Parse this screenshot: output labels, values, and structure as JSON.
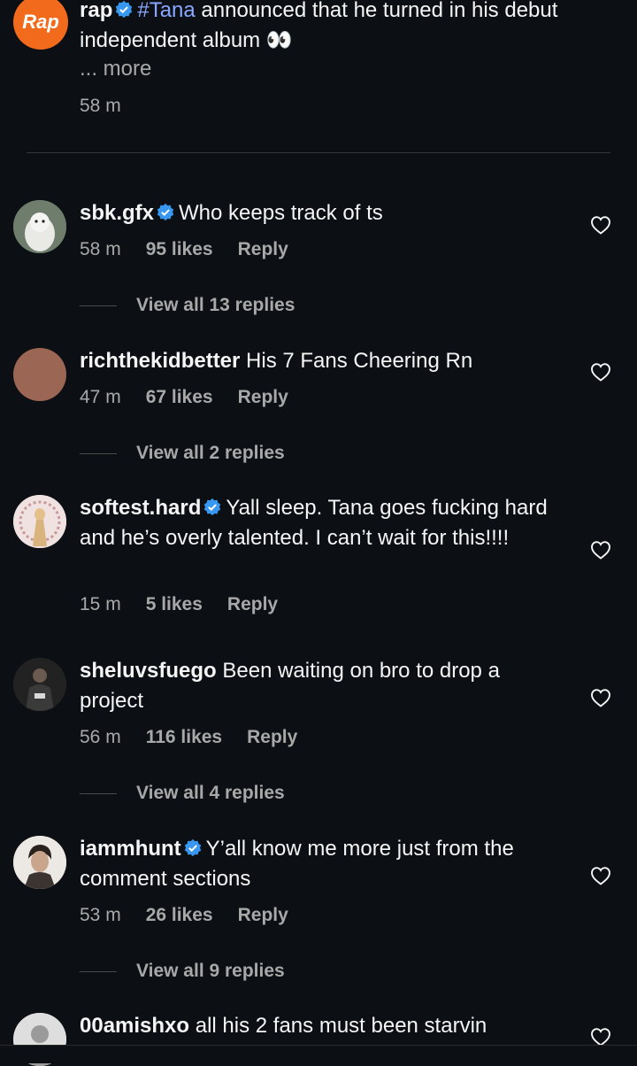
{
  "caption": {
    "username": "rap",
    "hashtag": "#Tana",
    "text": " announced that he turned in his debut independent album 👀",
    "more": "... more",
    "time": "58 m",
    "logo_text": "Rap"
  },
  "comments": [
    {
      "username": "sbk.gfx",
      "text": "Who keeps track of ts",
      "time": "58 m",
      "likes": "95 likes",
      "reply": "Reply",
      "view_replies": "View all 13 replies"
    },
    {
      "username": "richthekidbetter",
      "text": "His 7 Fans Cheering Rn",
      "time": "47 m",
      "likes": "67 likes",
      "reply": "Reply",
      "view_replies": "View all 2 replies"
    },
    {
      "username": "softest.hard",
      "text": "Yall sleep. Tana goes fucking hard and he’s overly talented. I can’t wait for this!!!!",
      "time": "15 m",
      "likes": "5 likes",
      "reply": "Reply"
    },
    {
      "username": "sheluvsfuego",
      "text": "Been waiting on bro to drop a project",
      "time": "56 m",
      "likes": "116 likes",
      "reply": "Reply",
      "view_replies": "View all 4 replies"
    },
    {
      "username": "iammhunt",
      "text": "Y’all know me more just from the comment sections",
      "time": "53 m",
      "likes": "26 likes",
      "reply": "Reply",
      "view_replies": "View all 9 replies"
    },
    {
      "username": "00amishxo",
      "text": "all his 2 fans must been starvin"
    }
  ],
  "colors": {
    "background": "#0c1014",
    "text": "#f5f5f5",
    "secondary": "#a8a8a8",
    "hashtag": "#8aa7ff",
    "verified": "#3897f0",
    "brand": "#f26a1b"
  },
  "icons": {
    "verified": "verified-badge-icon",
    "like": "heart-outline-icon"
  }
}
